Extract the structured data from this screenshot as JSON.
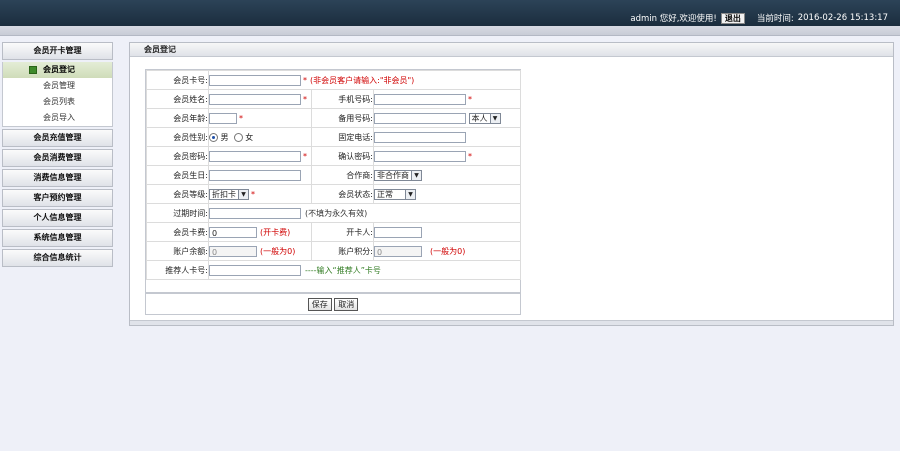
{
  "header": {
    "user_greeting": "admin 您好,欢迎使用!",
    "logout_label": "退出",
    "time_label": "当前时间:",
    "current_time": "2016-02-26 15:13:17"
  },
  "sidebar": {
    "group_membership": "会员开卡管理",
    "sub_items": [
      "会员登记",
      "会员管理",
      "会员列表",
      "会员导入"
    ],
    "other_groups": [
      "会员充值管理",
      "会员消费管理",
      "消费信息管理",
      "客户预约管理",
      "个人信息管理",
      "系统信息管理",
      "综合信息统计"
    ]
  },
  "panel": {
    "title": "会员登记"
  },
  "form": {
    "card_no_label": "会员卡号:",
    "card_no_hint": "(非会员客户请输入:\"非会员\")",
    "name_label": "会员姓名:",
    "mobile_label": "手机号码:",
    "age_label": "会员年龄:",
    "backup_phone_label": "备用号码:",
    "backup_phone_owner": "本人",
    "gender_label": "会员性别:",
    "gender_male": "男",
    "gender_female": "女",
    "landline_label": "固定电话:",
    "password_label": "会员密码:",
    "confirm_password_label": "确认密码:",
    "birthday_label": "会员生日:",
    "partner_label": "合作商:",
    "partner_value": "非合作商",
    "level_label": "会员等级:",
    "level_value": "折扣卡",
    "status_label": "会员状态:",
    "status_value": "正常",
    "expire_label": "过期时间:",
    "expire_hint": "(不填为永久有效)",
    "card_fee_label": "会员卡费:",
    "card_fee_value": "0",
    "card_fee_hint": "(开卡费)",
    "opener_label": "开卡人:",
    "balance_label": "账户余额:",
    "balance_value": "0",
    "balance_hint": "(一般为0)",
    "points_label": "账户积分:",
    "points_value": "0",
    "points_hint": "(一般为0)",
    "referrer_label": "推荐人卡号:",
    "referrer_hint": "----输入“推荐人”卡号",
    "required_mark": "*",
    "save_label": "保存",
    "cancel_label": "取消"
  }
}
